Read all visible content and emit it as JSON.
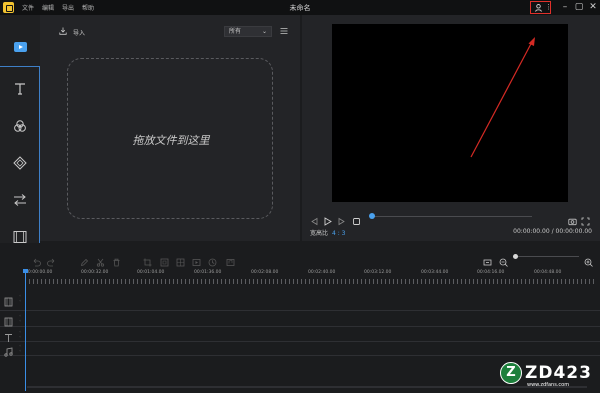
{
  "titlebar": {
    "menu": [
      "文件",
      "编辑",
      "导出",
      "帮助"
    ],
    "title": "未命名"
  },
  "media": {
    "import_label": "导入",
    "filter_selected": "所有",
    "drop_hint": "拖放文件到这里"
  },
  "preview": {
    "ratio_label": "宽高比",
    "ratio_value": "4 : 3",
    "timecode": "00:00:00.00 / 00:00:00.00",
    "progress": 0
  },
  "timeline": {
    "ruler": [
      "00:00:00.00",
      "00:00:32.00",
      "00:01:04.00",
      "00:01:36.00",
      "00:02:08.00",
      "00:02:40.00",
      "00:03:12.00",
      "00:03:44.00",
      "00:04:16.00",
      "00:04:48.00"
    ]
  },
  "watermark": {
    "badge": "Z",
    "text": "ZD423",
    "url": "www.zdfans.com"
  },
  "colors": {
    "accent": "#4aa1ee",
    "highlight_box": "#e0302a",
    "annotation_arrow": "#d42a24"
  }
}
